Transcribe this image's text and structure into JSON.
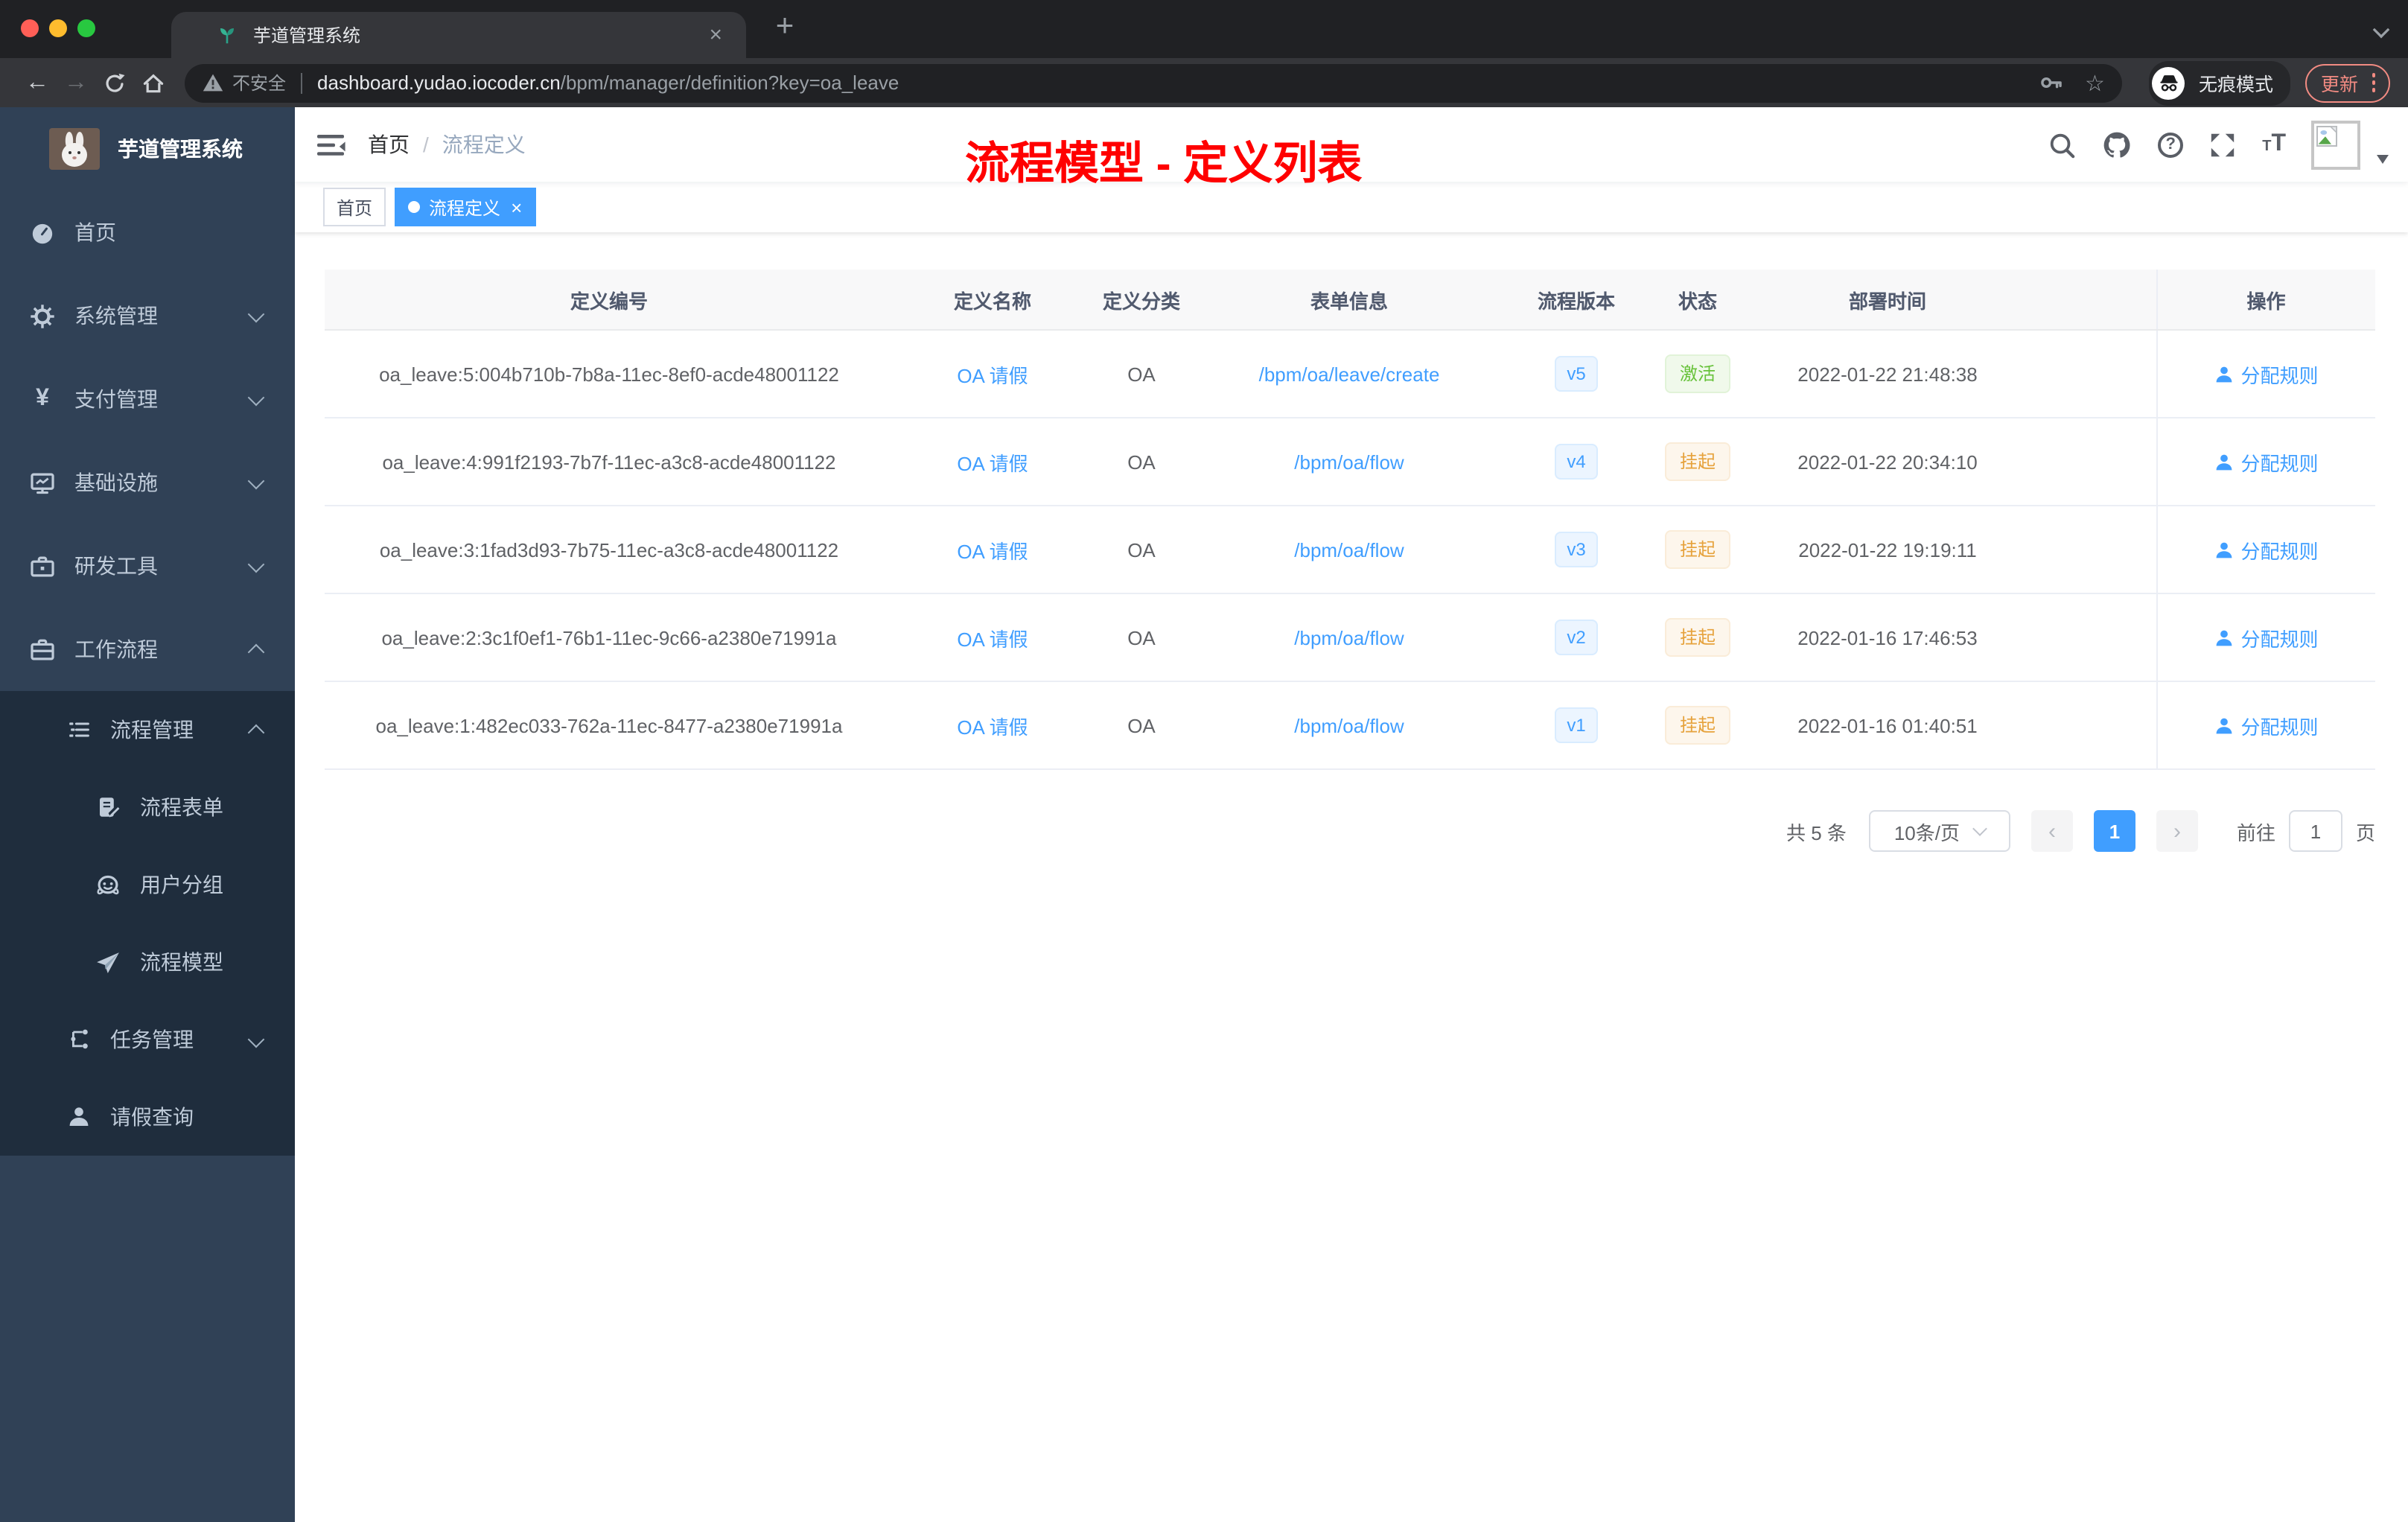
{
  "browser": {
    "tab_title": "芋道管理系统",
    "security_label": "不安全",
    "url_host": "dashboard.yudao.iocoder.cn",
    "url_path": "/bpm/manager/definition?key=oa_leave",
    "incognito_label": "无痕模式",
    "update_label": "更新",
    "traffic_light_colors": [
      "#ff5f57",
      "#febc2e",
      "#28c840"
    ]
  },
  "glyphs": {
    "close": "×",
    "new_tab": "+",
    "back": "←",
    "forward": "→",
    "star": "☆",
    "yen": "¥",
    "help": "?",
    "font_small": "T",
    "font_large": "T",
    "prev": "‹",
    "next": "›"
  },
  "sidebar": {
    "app_title": "芋道管理系统",
    "items": [
      {
        "label": "首页"
      },
      {
        "label": "系统管理"
      },
      {
        "label": "支付管理"
      },
      {
        "label": "基础设施"
      },
      {
        "label": "研发工具"
      },
      {
        "label": "工作流程"
      },
      {
        "label": "流程管理"
      },
      {
        "label": "流程表单"
      },
      {
        "label": "用户分组"
      },
      {
        "label": "流程模型"
      },
      {
        "label": "任务管理"
      },
      {
        "label": "请假查询"
      }
    ]
  },
  "navbar": {
    "breadcrumb_home": "首页",
    "breadcrumb_sep": "/",
    "breadcrumb_current": "流程定义",
    "annotation": "流程模型 - 定义列表",
    "annotation_color": "#ff0000"
  },
  "tags": {
    "home": "首页",
    "active": "流程定义"
  },
  "table": {
    "columns": [
      "定义编号",
      "定义名称",
      "定义分类",
      "表单信息",
      "流程版本",
      "状态",
      "部署时间",
      "操作"
    ],
    "rows": [
      {
        "id": "oa_leave:5:004b710b-7b8a-11ec-8ef0-acde48001122",
        "name": "OA 请假",
        "category": "OA",
        "form": "/bpm/oa/leave/create",
        "version": "v5",
        "status": "激活",
        "status_type": "success",
        "deployed": "2022-01-22 21:48:38",
        "action": "分配规则"
      },
      {
        "id": "oa_leave:4:991f2193-7b7f-11ec-a3c8-acde48001122",
        "name": "OA 请假",
        "category": "OA",
        "form": "/bpm/oa/flow",
        "version": "v4",
        "status": "挂起",
        "status_type": "warning",
        "deployed": "2022-01-22 20:34:10",
        "action": "分配规则"
      },
      {
        "id": "oa_leave:3:1fad3d93-7b75-11ec-a3c8-acde48001122",
        "name": "OA 请假",
        "category": "OA",
        "form": "/bpm/oa/flow",
        "version": "v3",
        "status": "挂起",
        "status_type": "warning",
        "deployed": "2022-01-22 19:19:11",
        "action": "分配规则"
      },
      {
        "id": "oa_leave:2:3c1f0ef1-76b1-11ec-9c66-a2380e71991a",
        "name": "OA 请假",
        "category": "OA",
        "form": "/bpm/oa/flow",
        "version": "v2",
        "status": "挂起",
        "status_type": "warning",
        "deployed": "2022-01-16 17:46:53",
        "action": "分配规则"
      },
      {
        "id": "oa_leave:1:482ec033-762a-11ec-8477-a2380e71991a",
        "name": "OA 请假",
        "category": "OA",
        "form": "/bpm/oa/flow",
        "version": "v1",
        "status": "挂起",
        "status_type": "warning",
        "deployed": "2022-01-16 01:40:51",
        "action": "分配规则"
      }
    ]
  },
  "pagination": {
    "total": "共 5 条",
    "page_size": "10条/页",
    "current": "1",
    "goto_label": "前往",
    "goto_value": "1",
    "unit": "页"
  },
  "colors": {
    "accent": "#409eff",
    "success": "#67c23a",
    "warning": "#e6a23c",
    "sidebar_bg": "#304156",
    "submenu_bg": "#1f2d3d"
  }
}
